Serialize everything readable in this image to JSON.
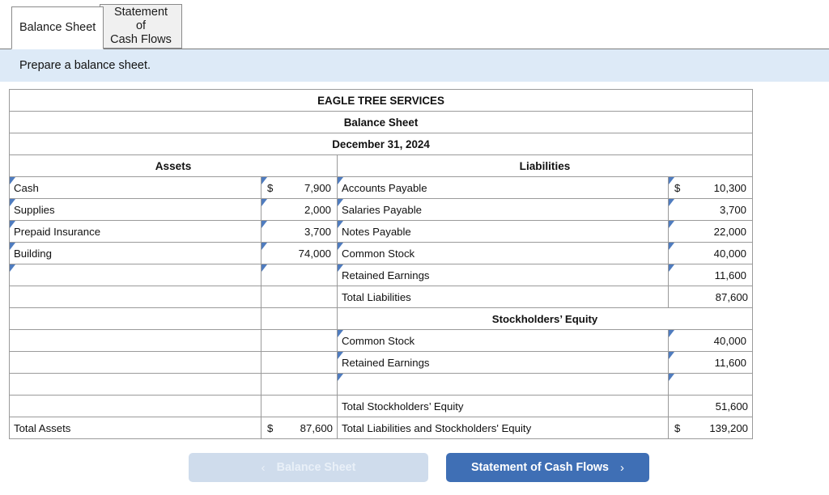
{
  "tabs": [
    {
      "label": "Balance Sheet",
      "active": true
    },
    {
      "label": "Statement of\nCash Flows",
      "active": false
    }
  ],
  "instruction": "Prepare a balance sheet.",
  "sheet": {
    "company": "EAGLE TREE SERVICES",
    "statement": "Balance Sheet",
    "date": "December 31, 2024",
    "assets_header": "Assets",
    "liabilities_header": "Liabilities",
    "equity_header": "Stockholders’ Equity",
    "currency_symbol": "$",
    "assets": [
      {
        "label": "Cash",
        "symbol": "$",
        "amount": "7,900"
      },
      {
        "label": "Supplies",
        "symbol": "",
        "amount": "2,000"
      },
      {
        "label": "Prepaid Insurance",
        "symbol": "",
        "amount": "3,700"
      },
      {
        "label": "Building",
        "symbol": "",
        "amount": "74,000"
      },
      {
        "label": "",
        "symbol": "",
        "amount": ""
      }
    ],
    "liabilities": [
      {
        "label": "Accounts Payable",
        "symbol": "$",
        "amount": "10,300"
      },
      {
        "label": "Salaries Payable",
        "symbol": "",
        "amount": "3,700"
      },
      {
        "label": "Notes Payable",
        "symbol": "",
        "amount": "22,000"
      },
      {
        "label": "Common Stock",
        "symbol": "",
        "amount": "40,000"
      },
      {
        "label": "Retained Earnings",
        "symbol": "",
        "amount": "11,600"
      }
    ],
    "total_liabilities": {
      "label": "Total Liabilities",
      "amount": "87,600"
    },
    "equity": [
      {
        "label": "Common Stock",
        "symbol": "",
        "amount": "40,000"
      },
      {
        "label": "Retained Earnings",
        "symbol": "",
        "amount": "11,600"
      },
      {
        "label": "",
        "symbol": "",
        "amount": ""
      }
    ],
    "total_equity": {
      "label": "Total Stockholders’ Equity",
      "amount": "51,600"
    },
    "total_assets": {
      "label": "Total Assets",
      "symbol": "$",
      "amount": "87,600"
    },
    "total_liab_and_equity": {
      "label": "Total Liabilities and Stockholders' Equity",
      "symbol": "$",
      "amount": "139,200"
    }
  },
  "footer": {
    "prev_label": "Balance Sheet",
    "prev_chevron": "‹",
    "next_label": "Statement of Cash Flows",
    "next_chevron": "›"
  },
  "colors": {
    "header_blue": "#84abdd",
    "instruction_blue": "#ddeaf7",
    "input_border": "#5b85c5",
    "next_button": "#3f6fb5",
    "prev_button": "#cfdcec"
  }
}
